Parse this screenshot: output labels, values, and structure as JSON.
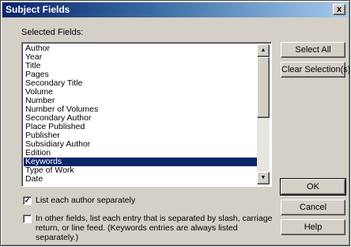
{
  "window": {
    "title": "Subject Fields",
    "close_glyph": "x"
  },
  "selected_fields_label": "Selected Fields:",
  "fields": [
    "Author",
    "Year",
    "Title",
    "Pages",
    "Secondary Title",
    "Volume",
    "Number",
    "Number of Volumes",
    "Secondary Author",
    "Place Published",
    "Publisher",
    "Subsidiary Author",
    "Edition",
    "Keywords",
    "Type of Work",
    "Date"
  ],
  "selected_field": "Keywords",
  "buttons": {
    "select_all": "Select All",
    "clear_selection": "Clear Selection(s)",
    "ok": "OK",
    "cancel": "Cancel",
    "help": "Help"
  },
  "options": {
    "list_authors_separately": {
      "label": "List each author separately",
      "checked": true
    },
    "list_entries_separated": {
      "label": "In other fields, list each entry that is separated by slash, carriage return, or line feed. (Keywords entries are always listed separately.)",
      "checked": false
    }
  },
  "icons": {
    "scroll_up": "triangle-up",
    "scroll_down": "triangle-down",
    "check": "checkmark"
  }
}
